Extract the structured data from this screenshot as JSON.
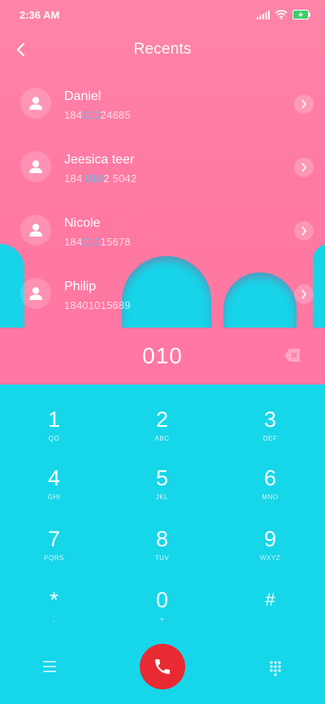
{
  "status_bar": {
    "time": "2:36 AM"
  },
  "header": {
    "title": "Recents"
  },
  "recents": [
    {
      "name": "Daniel",
      "number_pre": "184",
      "number_match": "010",
      "number_post": "24685"
    },
    {
      "name": "Jeesica teer",
      "number_pre": "184 ",
      "number_match": "010",
      "number_post": "2 5042"
    },
    {
      "name": "Nicole",
      "number_pre": "184",
      "number_match": "010",
      "number_post": "15678"
    },
    {
      "name": "Philip",
      "number_pre": "",
      "number_match": "",
      "number_post": "18401015689"
    }
  ],
  "dialer": {
    "entered_number": "010"
  },
  "keypad": [
    {
      "digit": "1",
      "letters": "QO"
    },
    {
      "digit": "2",
      "letters": "ABC"
    },
    {
      "digit": "3",
      "letters": "DEF"
    },
    {
      "digit": "4",
      "letters": "GHI"
    },
    {
      "digit": "5",
      "letters": "JKL"
    },
    {
      "digit": "6",
      "letters": "MNO"
    },
    {
      "digit": "7",
      "letters": "PQRS"
    },
    {
      "digit": "8",
      "letters": "TUV"
    },
    {
      "digit": "9",
      "letters": "WXYZ"
    },
    {
      "digit": "*",
      "letters": ","
    },
    {
      "digit": "0",
      "letters": "+"
    },
    {
      "digit": "#",
      "letters": ""
    }
  ],
  "colors": {
    "pink": "#ff77a2",
    "teal": "#16d6ea",
    "call": "#ea2a33",
    "highlight": "#63bdf2"
  }
}
